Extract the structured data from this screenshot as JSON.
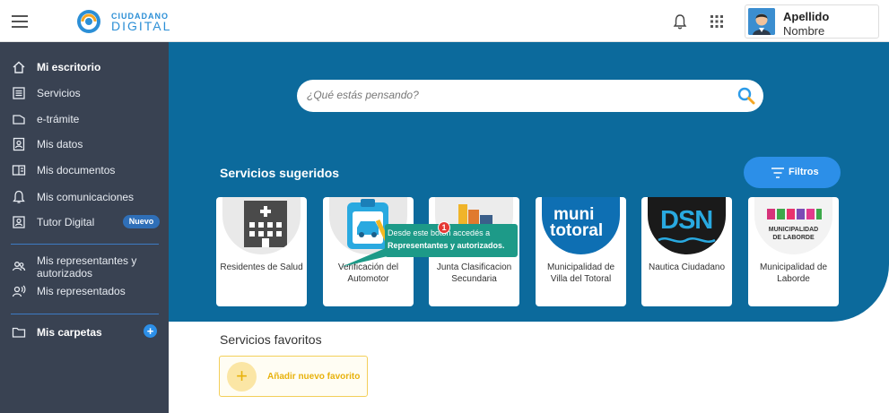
{
  "header": {
    "logo_line1": "CIUDADANO",
    "logo_line2": "DIGITAL",
    "user_lastname": "Apellido",
    "user_firstname": "Nombre",
    "icons": [
      "menu-icon",
      "bell-icon",
      "apps-grid-icon",
      "avatar"
    ]
  },
  "sidebar": {
    "items": [
      {
        "label": "Mi escritorio",
        "icon": "home-icon",
        "bold": true
      },
      {
        "label": "Servicios",
        "icon": "list-icon"
      },
      {
        "label": "e-trámite",
        "icon": "folder-tag-icon"
      },
      {
        "label": "Mis datos",
        "icon": "id-card-icon"
      },
      {
        "label": "Mis documentos",
        "icon": "documents-icon"
      },
      {
        "label": "Mis comunicaciones",
        "icon": "bell-icon"
      },
      {
        "label": "Tutor Digital",
        "icon": "tutor-icon",
        "badge": "Nuevo"
      },
      {
        "label": "Mis representantes y autorizados",
        "label_line1": "Mis representantes y",
        "label_line2": "autorizados",
        "icon": "people-icon"
      },
      {
        "label": "Mis representados",
        "icon": "person-voice-icon"
      },
      {
        "label": "Mis carpetas",
        "icon": "folder-icon",
        "bold": true
      }
    ]
  },
  "search": {
    "placeholder": "¿Qué estás pensando?"
  },
  "suggested": {
    "title": "Servicios sugeridos",
    "filter_label": "Filtros",
    "cards": [
      {
        "label": "Residentes de Salud",
        "icon": "hospital-building-icon"
      },
      {
        "label": "Verificación del Automotor",
        "icon": "vehicle-clipboard-icon"
      },
      {
        "label": "Junta Clasificacion Secundaria",
        "icon": "books-icon"
      },
      {
        "label": "Municipalidad de Villa del Totoral",
        "logo_line1": "muni",
        "logo_line2": "totoral"
      },
      {
        "label": "Nautica Ciudadano",
        "logo_text": "DSN"
      },
      {
        "label": "Municipalidad de Laborde",
        "logo_line1": "MUNICIPALIDAD",
        "logo_line2": "DE LABORDE"
      }
    ]
  },
  "tooltip": {
    "badge": "1",
    "line1": "Desde este botón accedés a",
    "line2": "Representantes y autorizados."
  },
  "favorites": {
    "title": "Servicios favoritos",
    "add_label": "Añadir nuevo favorito",
    "add_symbol": "+"
  },
  "colors": {
    "hero": "#0c6a9c",
    "sidebar": "#394252",
    "accent": "#2c8fe8",
    "tooltip": "#1d9a88",
    "favorite": "#e8b20c"
  }
}
